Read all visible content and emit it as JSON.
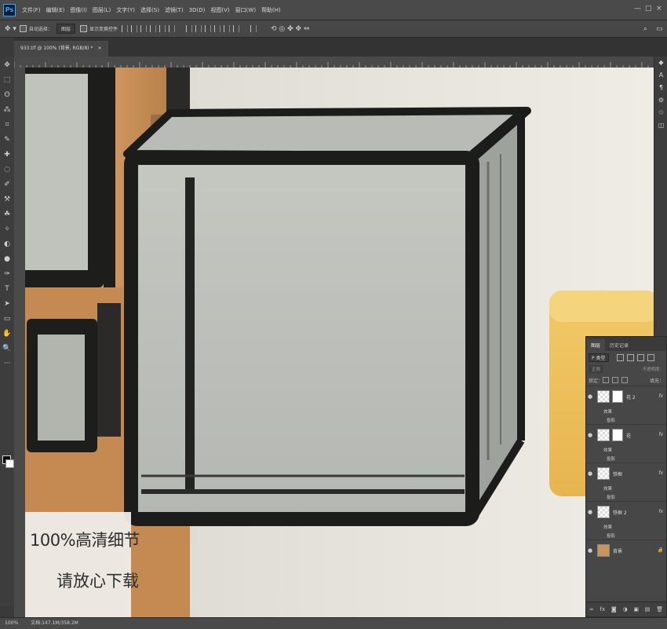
{
  "app": {
    "logo": "Ps"
  },
  "menu": [
    "文件(F)",
    "编辑(E)",
    "图像(I)",
    "图层(L)",
    "文字(Y)",
    "选择(S)",
    "滤镜(T)",
    "3D(D)",
    "视图(V)",
    "窗口(W)",
    "帮助(H)"
  ],
  "window_controls": [
    "—",
    "□",
    "×"
  ],
  "options": {
    "move_icon": "move-tool-icon",
    "auto_select_label": "自动选择：",
    "auto_select_target": "图层",
    "transform_label": "显示变换控件"
  },
  "document_tab": {
    "title": "933.tif @ 100% (背景, RGB/8) *",
    "close": "×"
  },
  "tools": [
    "✥",
    "⬚",
    "ʘ",
    "⁂",
    "⌗",
    "✎",
    "✚",
    "◌",
    "✐",
    "⚒",
    "☘",
    "✧",
    "◐",
    "●",
    "✑",
    "T",
    "➤",
    "▭",
    "✋",
    "🔍",
    "···"
  ],
  "right_dock": [
    "◆",
    "A",
    "¶",
    "⚙",
    "♲",
    "◫"
  ],
  "watermark": {
    "line1": "100%高清细节",
    "line2": "请放心下载"
  },
  "layers_panel": {
    "tabs": [
      "图层",
      "历史记录"
    ],
    "filter_kind": "P 类型",
    "blend_mode": "正常",
    "opacity_label": "不透明度：",
    "lock_label": "锁定：",
    "fill_label": "填充：",
    "layers": [
      {
        "name": "花 2",
        "has_mask": true,
        "fx": "fx",
        "effects_label": "效果",
        "effect": "投影"
      },
      {
        "name": "花",
        "has_mask": true,
        "fx": "fx",
        "effects_label": "效果",
        "effect": "投影"
      },
      {
        "name": "铁框",
        "has_mask": false,
        "fx": "fx",
        "effects_label": "效果",
        "effect": "投影"
      },
      {
        "name": "铁框 2",
        "has_mask": false,
        "fx": "fx",
        "effects_label": "效果",
        "effect": "投影"
      },
      {
        "name": "背景",
        "has_mask": false,
        "locked": true
      }
    ],
    "bottom_icons": [
      "∞",
      "fx",
      "◙",
      "◑",
      "▣",
      "▤",
      "🗑"
    ]
  },
  "status": {
    "zoom": "100%",
    "doc": "文档:147.1M/358.2M"
  }
}
